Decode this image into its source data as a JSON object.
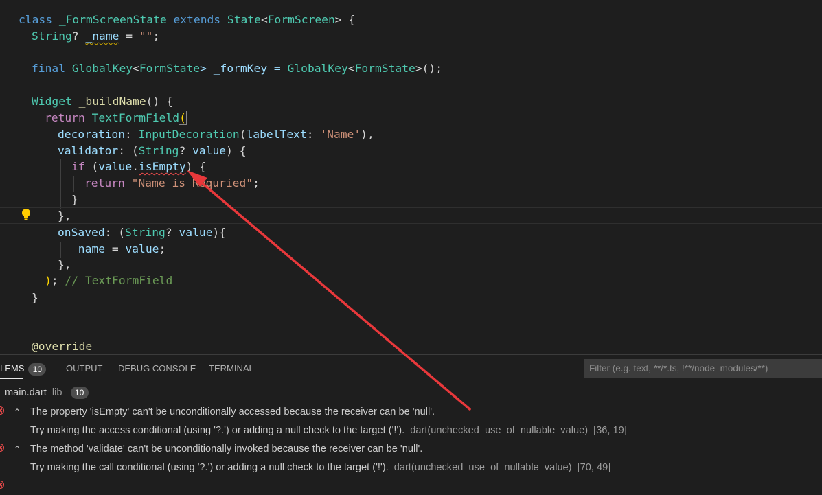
{
  "editor": {
    "line1": {
      "kw_class": "class",
      "cls": "_FormScreenState",
      "kw_extends": "extends",
      "state": "State",
      "lt": "<",
      "fs": "FormScreen",
      "rest": "> {"
    },
    "line2": {
      "ty": "String",
      "q": "? ",
      "var": "_name",
      "eq": " = ",
      "str": "\"\"",
      "semi": ";"
    },
    "line3": {
      "kw": "final",
      "ty": "GlobalKey",
      "lt": "<",
      "fs": "FormState",
      "mid": "> _formKey = ",
      "ty2": "GlobalKey",
      "lt2": "<",
      "fs2": "FormState",
      "end": ">();"
    },
    "line4": {
      "ty": "Widget",
      "fn": " _buildName",
      "rest": "() {"
    },
    "line5": {
      "kw": "return",
      "fn": " TextFormField",
      "paren": "("
    },
    "line6": {
      "prop": "decoration",
      "colon": ": ",
      "cls": "InputDecoration",
      "open": "(",
      "lbl": "labelText",
      "colon2": ": ",
      "str": "'Name'",
      "end": "),"
    },
    "line7": {
      "prop": "validator",
      "colon": ": (",
      "ty": "String",
      "q": "? ",
      "var": "value",
      "end": ") {"
    },
    "line8": {
      "kw": "if",
      "open": " (",
      "var": "value",
      "dot": ".",
      "prop": "isEmpty",
      "end": ") {"
    },
    "line9": {
      "kw": "return",
      "str": " \"Name is Requried\"",
      "semi": ";"
    },
    "line10": {
      "text": "}"
    },
    "line11": {
      "text": "},"
    },
    "line12": {
      "prop": "onSaved",
      "colon": ": (",
      "ty": "String",
      "q": "? ",
      "var": "value",
      "end": "){"
    },
    "line13": {
      "var": "_name",
      "eq": " = ",
      "var2": "value",
      "semi": ";"
    },
    "line14": {
      "text": "},"
    },
    "line15": {
      "paren": ")",
      "semi": "; ",
      "comment": "// TextFormField"
    },
    "line16": {
      "text": "}"
    },
    "line17": {
      "anno": "@override"
    }
  },
  "panel": {
    "tabs": [
      {
        "label": "LEMS",
        "badge": "10"
      },
      {
        "label": "OUTPUT"
      },
      {
        "label": "DEBUG CONSOLE"
      },
      {
        "label": "TERMINAL"
      }
    ],
    "filter_placeholder": "Filter (e.g. text, **/*.ts, !**/node_modules/**)",
    "file": {
      "name": "main.dart",
      "folder": "lib",
      "count": "10"
    },
    "problems": [
      {
        "message": "The property 'isEmpty' can't be unconditionally accessed because the receiver can be 'null'.",
        "hint": "Try making the access conditional (using '?.') or adding a null check to the target ('!').",
        "code": "dart(unchecked_use_of_nullable_value)",
        "pos": "[36, 19]"
      },
      {
        "message": "The method 'validate' can't be unconditionally invoked because the receiver can be 'null'.",
        "hint": "Try making the call conditional (using '?.') or adding a null check to the target ('!').",
        "code": "dart(unchecked_use_of_nullable_value)",
        "pos": "[70, 49]"
      }
    ]
  },
  "colors": {
    "arrow": "#e8383b",
    "error": "#f14c4c",
    "warning": "#cca700"
  }
}
